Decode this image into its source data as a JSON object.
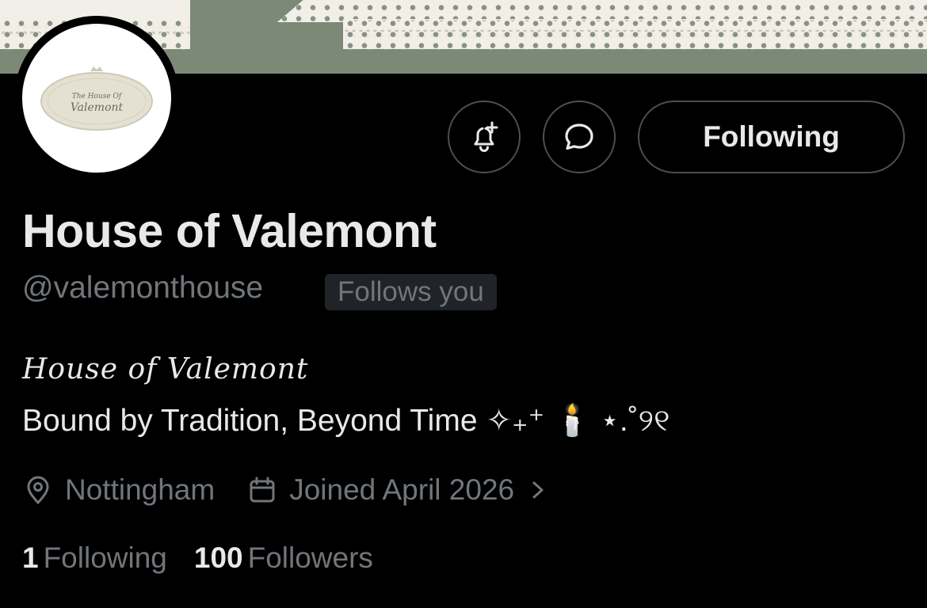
{
  "banner": {
    "colors": {
      "background": "#7d8977",
      "lace": "#f2efe8"
    }
  },
  "avatar": {
    "logo_line1": "The House Of",
    "logo_line2": "Valemont"
  },
  "actions": {
    "notify_icon": "bell-plus-icon",
    "message_icon": "chat-bubble-icon",
    "follow_label": "Following"
  },
  "profile": {
    "display_name": "House of Valemont",
    "handle": "@valemonthouse",
    "follows_you": "Follows you",
    "bio_title": "House of Valemont",
    "bio_text": "Bound by Tradition, Beyond Time ✧₊⁺ 🕯️ ⋆.˚୨୧",
    "location": "Nottingham",
    "location_icon": "location-pin-icon",
    "joined": "Joined April 2026",
    "joined_icon": "calendar-icon"
  },
  "stats": {
    "following_count": "1",
    "following_label": "Following",
    "followers_count": "100",
    "followers_label": "Followers"
  },
  "colors": {
    "text_primary": "#e7e9ea",
    "text_secondary": "#71767b",
    "border": "#4b4f53",
    "badge_bg": "#202327"
  }
}
